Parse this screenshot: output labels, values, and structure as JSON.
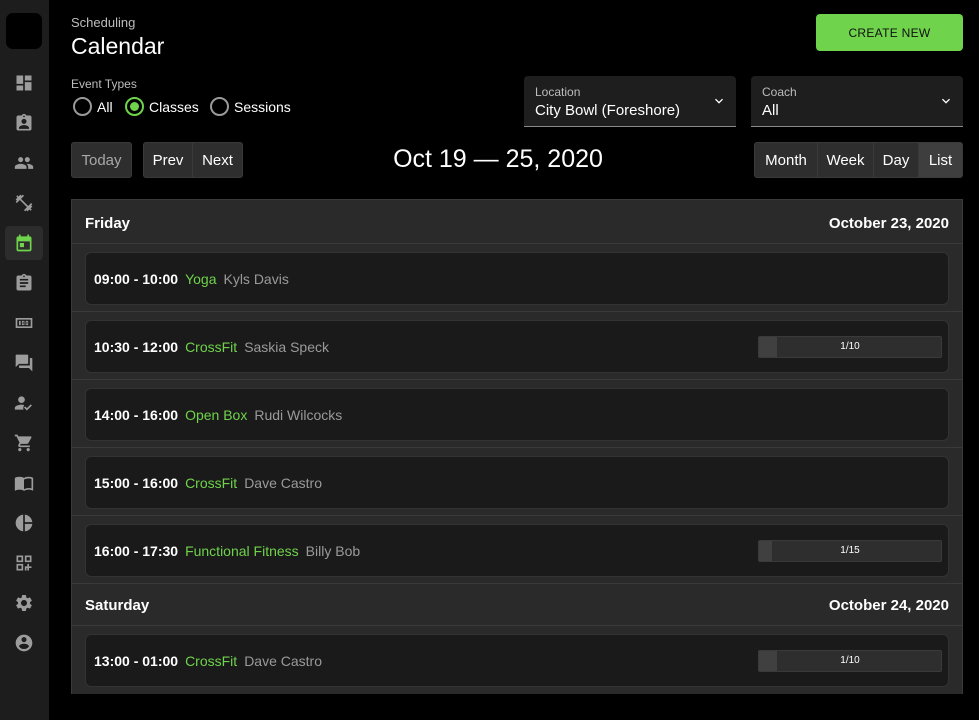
{
  "header": {
    "subtitle": "Scheduling",
    "title": "Calendar",
    "create_label": "CREATE NEW"
  },
  "event_types": {
    "label": "Event Types",
    "options": [
      "All",
      "Classes",
      "Sessions"
    ],
    "selected": "Classes"
  },
  "location": {
    "label": "Location",
    "value": "City Bowl (Foreshore)"
  },
  "coach": {
    "label": "Coach",
    "value": "All"
  },
  "toolbar": {
    "today": "Today",
    "prev": "Prev",
    "next": "Next",
    "range": "Oct 19 — 25, 2020",
    "views": [
      "Month",
      "Week",
      "Day",
      "List"
    ],
    "active_view": "List"
  },
  "days": [
    {
      "name": "Friday",
      "date": "October 23, 2020",
      "events": [
        {
          "time": "09:00 - 10:00",
          "class": "Yoga",
          "coach": "Kyls Davis",
          "capacity": null
        },
        {
          "time": "10:30 - 12:00",
          "class": "CrossFit",
          "coach": "Saskia Speck",
          "capacity": "1/10"
        },
        {
          "time": "14:00 - 16:00",
          "class": "Open Box",
          "coach": "Rudi Wilcocks",
          "capacity": null
        },
        {
          "time": "15:00 - 16:00",
          "class": "CrossFit",
          "coach": "Dave Castro",
          "capacity": null
        },
        {
          "time": "16:00 - 17:30",
          "class": "Functional Fitness",
          "coach": "Billy Bob",
          "capacity": "1/15"
        }
      ]
    },
    {
      "name": "Saturday",
      "date": "October 24, 2020",
      "events": [
        {
          "time": "13:00 - 01:00",
          "class": "CrossFit",
          "coach": "Dave Castro",
          "capacity": "1/10"
        }
      ]
    }
  ],
  "nav": [
    "dashboard-icon",
    "clipboard-user-icon",
    "people-icon",
    "fitness-icon",
    "calendar-icon",
    "assignment-icon",
    "scoreboard-icon",
    "chat-icon",
    "person-check-icon",
    "cart-icon",
    "book-icon",
    "pie-chart-icon",
    "qr-code-icon",
    "settings-icon",
    "account-icon"
  ],
  "colors": {
    "accent": "#6fd34b",
    "background": "#000000",
    "sidebar": "#1d1d1d"
  }
}
